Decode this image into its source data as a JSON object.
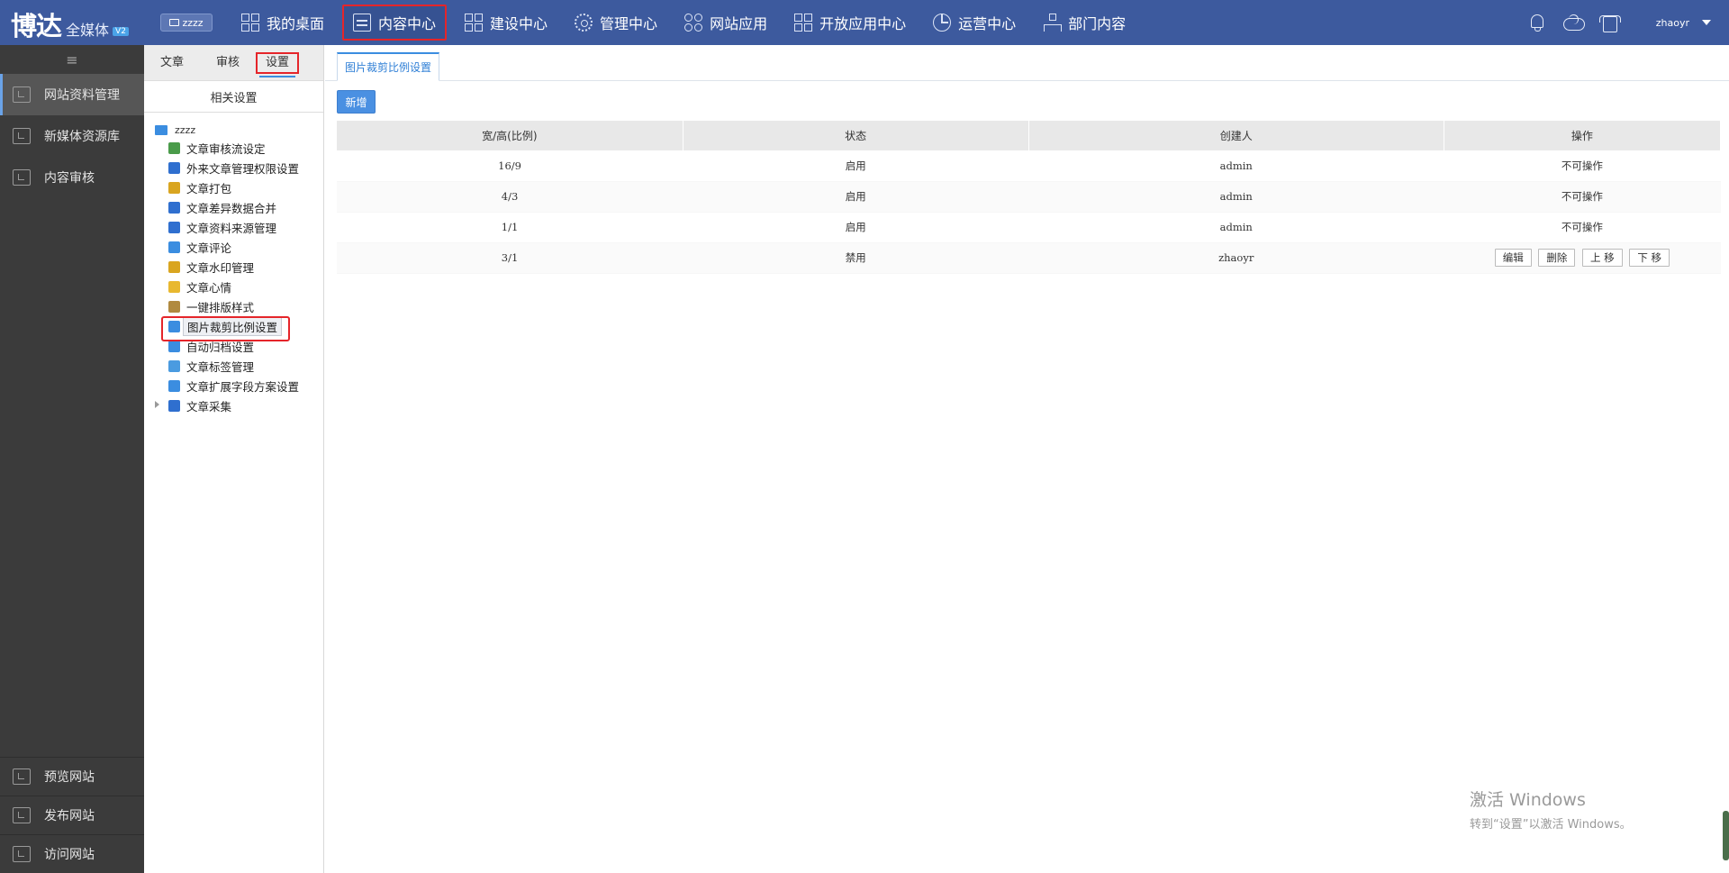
{
  "header": {
    "logo_main": "博达",
    "logo_sub": "全媒体",
    "logo_version": "V2",
    "site": "zzzz",
    "nav": [
      {
        "label": "我的桌面"
      },
      {
        "label": "内容中心"
      },
      {
        "label": "建设中心"
      },
      {
        "label": "管理中心"
      },
      {
        "label": "网站应用"
      },
      {
        "label": "开放应用中心"
      },
      {
        "label": "运营中心"
      },
      {
        "label": "部门内容"
      }
    ],
    "user": "zhaoyr"
  },
  "sidebar": {
    "items": [
      {
        "label": "网站资料管理"
      },
      {
        "label": "新媒体资源库"
      },
      {
        "label": "内容审核"
      }
    ],
    "bottom": [
      {
        "label": "预览网站"
      },
      {
        "label": "发布网站"
      },
      {
        "label": "访问网站"
      }
    ]
  },
  "panel": {
    "tabs": [
      "文章",
      "审核",
      "设置"
    ],
    "sub_title": "相关设置",
    "tree_root": "zzzz",
    "tree": [
      {
        "label": "文章审核流设定",
        "color": "#4a9b4a"
      },
      {
        "label": "外来文章管理权限设置",
        "color": "#2f6fcf"
      },
      {
        "label": "文章打包",
        "color": "#d9a520"
      },
      {
        "label": "文章差异数据合并",
        "color": "#2f6fcf"
      },
      {
        "label": "文章资料来源管理",
        "color": "#2f6fcf"
      },
      {
        "label": "文章评论",
        "color": "#3b8de0"
      },
      {
        "label": "文章水印管理",
        "color": "#d9a520"
      },
      {
        "label": "文章心情",
        "color": "#e8b830"
      },
      {
        "label": "一键排版样式",
        "color": "#b08a40"
      },
      {
        "label": "图片裁剪比例设置",
        "color": "#3b8de0"
      },
      {
        "label": "自动归档设置",
        "color": "#3b8de0"
      },
      {
        "label": "文章标签管理",
        "color": "#4a9be0"
      },
      {
        "label": "文章扩展字段方案设置",
        "color": "#3b8de0"
      },
      {
        "label": "文章采集",
        "color": "#2f6fcf"
      }
    ]
  },
  "main": {
    "tab": "图片裁剪比例设置",
    "add_button": "新增",
    "columns": [
      "宽/高(比例)",
      "状态",
      "创建人",
      "操作"
    ],
    "rows": [
      {
        "ratio": "16/9",
        "status": "启用",
        "creator": "admin",
        "op": "不可操作"
      },
      {
        "ratio": "4/3",
        "status": "启用",
        "creator": "admin",
        "op": "不可操作"
      },
      {
        "ratio": "1/1",
        "status": "启用",
        "creator": "admin",
        "op": "不可操作"
      },
      {
        "ratio": "3/1",
        "status": "禁用",
        "creator": "zhaoyr",
        "op": ""
      }
    ],
    "row_actions": [
      "编辑",
      "删除",
      "上 移",
      "下 移"
    ]
  },
  "watermark": {
    "line1": "激活 Windows",
    "line2": "转到“设置”以激活 Windows。"
  }
}
